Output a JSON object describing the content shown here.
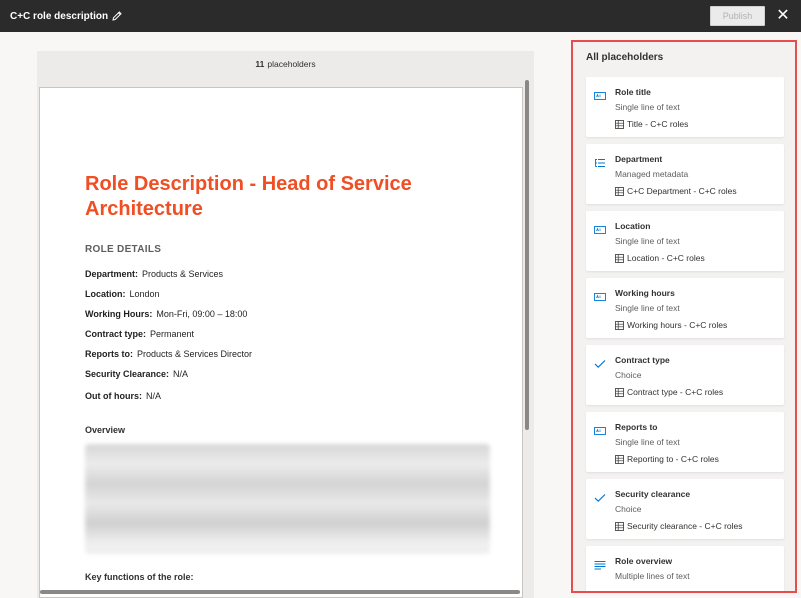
{
  "header": {
    "title": "C+C role description",
    "publish_label": "Publish",
    "close_label": "✕"
  },
  "document": {
    "placeholder_count": "11",
    "placeholder_count_label": "placeholders",
    "title": "Role Description - Head of Service Architecture",
    "section_heading": "ROLE DETAILS",
    "details": [
      {
        "label": "Department:",
        "value": "Products & Services"
      },
      {
        "label": "Location:",
        "value": "London"
      },
      {
        "label": "Working Hours:",
        "value": "Mon-Fri, 09:00 – 18:00"
      },
      {
        "label": "Contract type:",
        "value": "Permanent"
      },
      {
        "label": "Reports to:",
        "value": "Products & Services Director"
      },
      {
        "label": "Security Clearance:",
        "value": "N/A"
      },
      {
        "label": "Out of hours:",
        "value": "N/A"
      }
    ],
    "overview_heading": "Overview",
    "key_functions_heading": "Key functions of the role:"
  },
  "panel": {
    "title": "All placeholders",
    "cards": [
      {
        "name": "Role title",
        "type": "Single line of text",
        "source": "Title - C+C roles",
        "icon": "text-field-icon"
      },
      {
        "name": "Department",
        "type": "Managed metadata",
        "source": "C+C Department - C+C roles",
        "icon": "tree-icon"
      },
      {
        "name": "Location",
        "type": "Single line of text",
        "source": "Location - C+C roles",
        "icon": "text-field-icon"
      },
      {
        "name": "Working hours",
        "type": "Single line of text",
        "source": "Working hours - C+C roles",
        "icon": "text-field-icon"
      },
      {
        "name": "Contract type",
        "type": "Choice",
        "source": "Contract type - C+C roles",
        "icon": "checkmark-icon"
      },
      {
        "name": "Reports to",
        "type": "Single line of text",
        "source": "Reporting to - C+C roles",
        "icon": "text-field-icon"
      },
      {
        "name": "Security clearance",
        "type": "Choice",
        "source": "Security clearance - C+C roles",
        "icon": "checkmark-icon"
      },
      {
        "name": "Role overview",
        "type": "Multiple lines of text",
        "source": "",
        "icon": "multiline-icon"
      }
    ]
  },
  "colors": {
    "accent": "#f04e23",
    "highlight_border": "#e84c4c",
    "topbar": "#2b2b2b",
    "icon_blue": "#0078d4"
  }
}
